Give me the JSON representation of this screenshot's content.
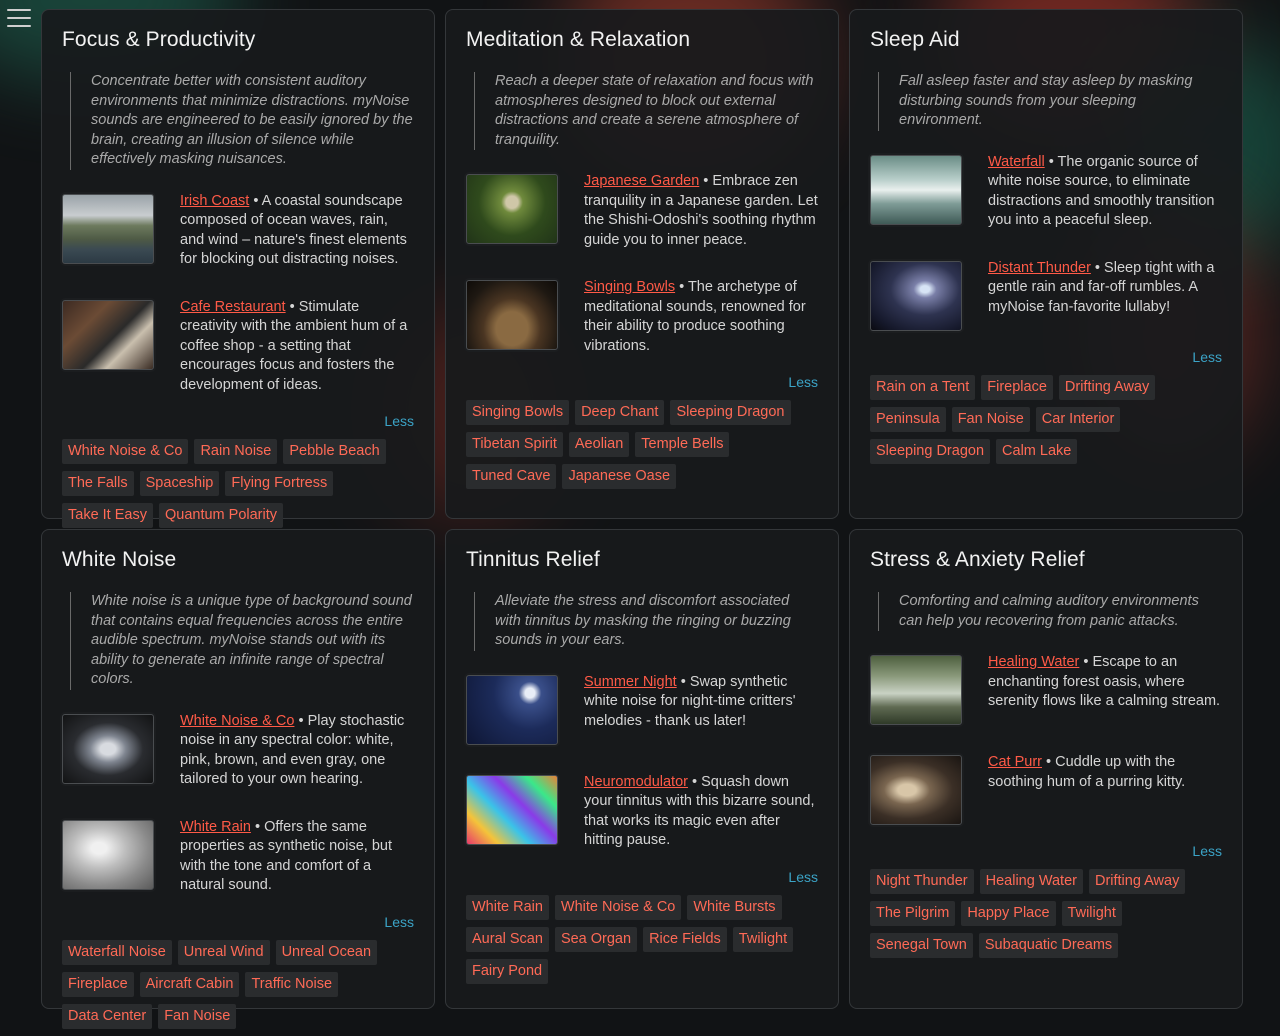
{
  "cards": [
    {
      "title": "Focus & Productivity",
      "description": "Concentrate better with consistent auditory environments that minimize distractions. myNoise sounds are engineered to be easily ignored by the brain, creating an illusion of silence while effectively masking nuisances.",
      "sounds": [
        {
          "name": "Irish Coast",
          "text": "A coastal soundscape composed of ocean waves, rain, and wind – nature's finest elements for blocking out distracting noises."
        },
        {
          "name": "Cafe Restaurant",
          "text": "Stimulate creativity with the ambient hum of a coffee shop - a setting that encourages focus and fosters the development of ideas."
        }
      ],
      "less": "Less",
      "tags": [
        "White Noise & Co",
        "Rain Noise",
        "Pebble Beach",
        "The Falls",
        "Spaceship",
        "Flying Fortress",
        "Take It Easy",
        "Quantum Polarity"
      ]
    },
    {
      "title": "Meditation & Relaxation",
      "description": "Reach a deeper state of relaxation and focus with atmospheres designed to block out external distractions and create a serene atmosphere of tranquility.",
      "sounds": [
        {
          "name": "Japanese Garden",
          "text": "Embrace zen tranquility in a Japanese garden. Let the Shishi-Odoshi's soothing rhythm guide you to inner peace."
        },
        {
          "name": "Singing Bowls",
          "text": "The archetype of meditational sounds, renowned for their ability to produce soothing vibrations."
        }
      ],
      "less": "Less",
      "tags": [
        "Singing Bowls",
        "Deep Chant",
        "Sleeping Dragon",
        "Tibetan Spirit",
        "Aeolian",
        "Temple Bells",
        "Tuned Cave",
        "Japanese Oase"
      ]
    },
    {
      "title": "Sleep Aid",
      "description": "Fall asleep faster and stay asleep by masking disturbing sounds from your sleeping environment.",
      "sounds": [
        {
          "name": "Waterfall",
          "text": "The organic source of white noise source, to eliminate distractions and smoothly transition you into a peaceful sleep."
        },
        {
          "name": "Distant Thunder",
          "text": "Sleep tight with a gentle rain and far-off rumbles. A myNoise fan-favorite lullaby!"
        }
      ],
      "less": "Less",
      "tags": [
        "Rain on a Tent",
        "Fireplace",
        "Drifting Away",
        "Peninsula",
        "Fan Noise",
        "Car Interior",
        "Sleeping Dragon",
        "Calm Lake"
      ]
    },
    {
      "title": "White Noise",
      "description": "White noise is a unique type of background sound that contains equal frequencies across the entire audible spectrum. myNoise stands out with its ability to generate an infinite range of spectral colors.",
      "sounds": [
        {
          "name": "White Noise & Co",
          "text": "Play stochastic noise in any spectral color: white, pink, brown, and even gray, one tailored to your own hearing."
        },
        {
          "name": "White Rain",
          "text": "Offers the same properties as synthetic noise, but with the tone and comfort of a natural sound."
        }
      ],
      "less": "Less",
      "tags": [
        "Waterfall Noise",
        "Unreal Wind",
        "Unreal Ocean",
        "Fireplace",
        "Aircraft Cabin",
        "Traffic Noise",
        "Data Center",
        "Fan Noise"
      ]
    },
    {
      "title": "Tinnitus Relief",
      "description": "Alleviate the stress and discomfort associated with tinnitus by masking the ringing or buzzing sounds in your ears.",
      "sounds": [
        {
          "name": "Summer Night",
          "text": "Swap synthetic white noise for night-time critters' melodies - thank us later!"
        },
        {
          "name": "Neuromodulator",
          "text": "Squash down your tinnitus with this bizarre sound, that works its magic even after hitting pause."
        }
      ],
      "less": "Less",
      "tags": [
        "White Rain",
        "White Noise & Co",
        "White Bursts",
        "Aural Scan",
        "Sea Organ",
        "Rice Fields",
        "Twilight",
        "Fairy Pond"
      ]
    },
    {
      "title": "Stress & Anxiety Relief",
      "description": "Comforting and calming auditory environments can help you recovering from panic attacks.",
      "sounds": [
        {
          "name": "Healing Water",
          "text": "Escape to an enchanting forest oasis, where serenity flows like a calming stream."
        },
        {
          "name": "Cat Purr",
          "text": "Cuddle up with the soothing hum of a purring kitty."
        }
      ],
      "less": "Less",
      "tags": [
        "Night Thunder",
        "Healing Water",
        "Drifting Away",
        "The Pilgrim",
        "Happy Place",
        "Twilight",
        "Senegal Town",
        "Subaquatic Dreams"
      ]
    }
  ],
  "colors": {
    "link": "#ff5a47",
    "less": "#3ba3c6",
    "tag_bg": "#2a2c2e",
    "card_bg": "#181a1c"
  },
  "icons": {
    "menu": "hamburger-menu-icon"
  }
}
